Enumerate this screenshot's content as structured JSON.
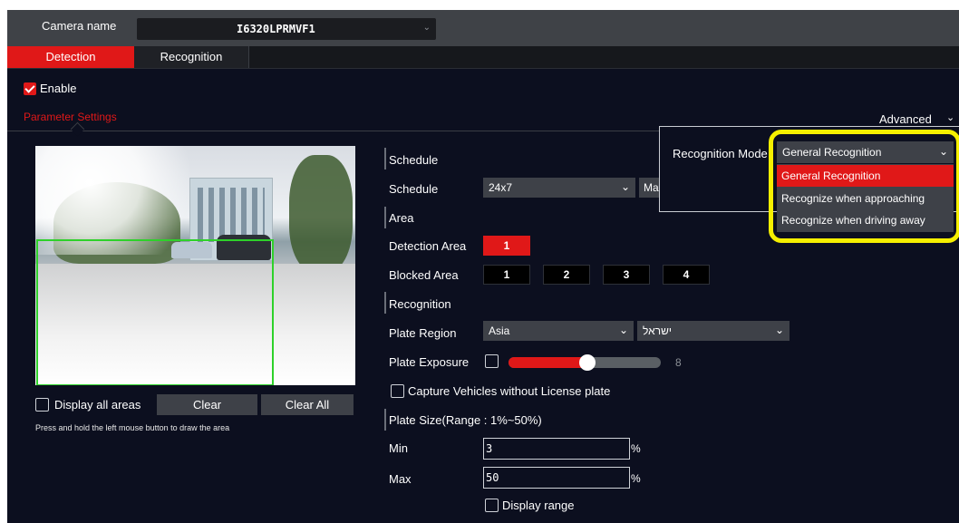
{
  "camera": {
    "label": "Camera name",
    "value": "I6320LPRMVF1"
  },
  "tabs": [
    {
      "label": "Detection"
    },
    {
      "label": "Recognition"
    }
  ],
  "enable_label": "Enable",
  "parameter_settings": "Parameter Settings",
  "advanced": "Advanced",
  "preview": {
    "display_all_areas": "Display all areas",
    "clear": "Clear",
    "clear_all": "Clear All",
    "hint": "Press and hold the left mouse button to draw the area"
  },
  "schedule": {
    "section": "Schedule",
    "label": "Schedule",
    "value": "24x7",
    "next_value_partial": "Ma"
  },
  "area": {
    "section": "Area",
    "detection_label": "Detection Area",
    "detection_areas": [
      "1"
    ],
    "blocked_label": "Blocked Area",
    "blocked_areas": [
      "1",
      "2",
      "3",
      "4"
    ]
  },
  "recognition": {
    "section": "Recognition",
    "plate_region_label": "Plate Region",
    "plate_region_value": "Asia",
    "plate_country_value": "ישראל",
    "plate_exposure_label": "Plate Exposure",
    "plate_exposure_value": "8",
    "plate_exposure_fraction": 0.52,
    "capture_without_plate": "Capture Vehicles without License plate"
  },
  "plate_size": {
    "section": "Plate Size(Range : 1%~50%)",
    "min_label": "Min",
    "min_value": "3",
    "max_label": "Max",
    "max_value": "50",
    "unit": "%",
    "display_range": "Display range"
  },
  "recognition_mode": {
    "label": "Recognition Mode",
    "value": "General Recognition",
    "options": [
      "General Recognition",
      "Recognize when approaching",
      "Recognize when driving away"
    ]
  },
  "colors": {
    "accent": "#e01818",
    "highlight": "#f5ef00",
    "zone": "#2ed12a"
  }
}
